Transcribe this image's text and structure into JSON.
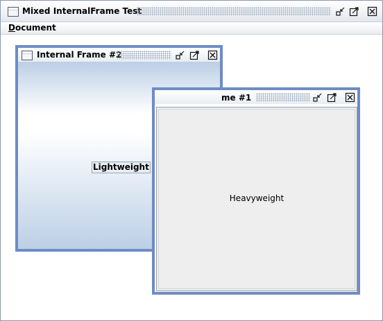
{
  "window": {
    "title": "Mixed InternalFrame Test",
    "menu": [
      {
        "label": "Document",
        "mnemonic": "D",
        "rest": "ocument"
      }
    ]
  },
  "frame1": {
    "title": "Internal Frame #1",
    "title_visible": "me #1",
    "content_label": "Heavyweight"
  },
  "frame2": {
    "title": "Internal Frame #2",
    "content_label": "Lightweight"
  },
  "icons": {
    "window": [
      "window-icon",
      "iconify-icon",
      "maximize-icon",
      "close-icon"
    ],
    "frame": [
      "frame-icon",
      "iconify-icon",
      "maximize-icon",
      "close-icon"
    ]
  },
  "colors": {
    "frame_border": "#6e8cc5",
    "lightweight_gradient": [
      "#ffffff",
      "#bccfe6"
    ],
    "heavyweight_bg": "#eeeeee"
  }
}
